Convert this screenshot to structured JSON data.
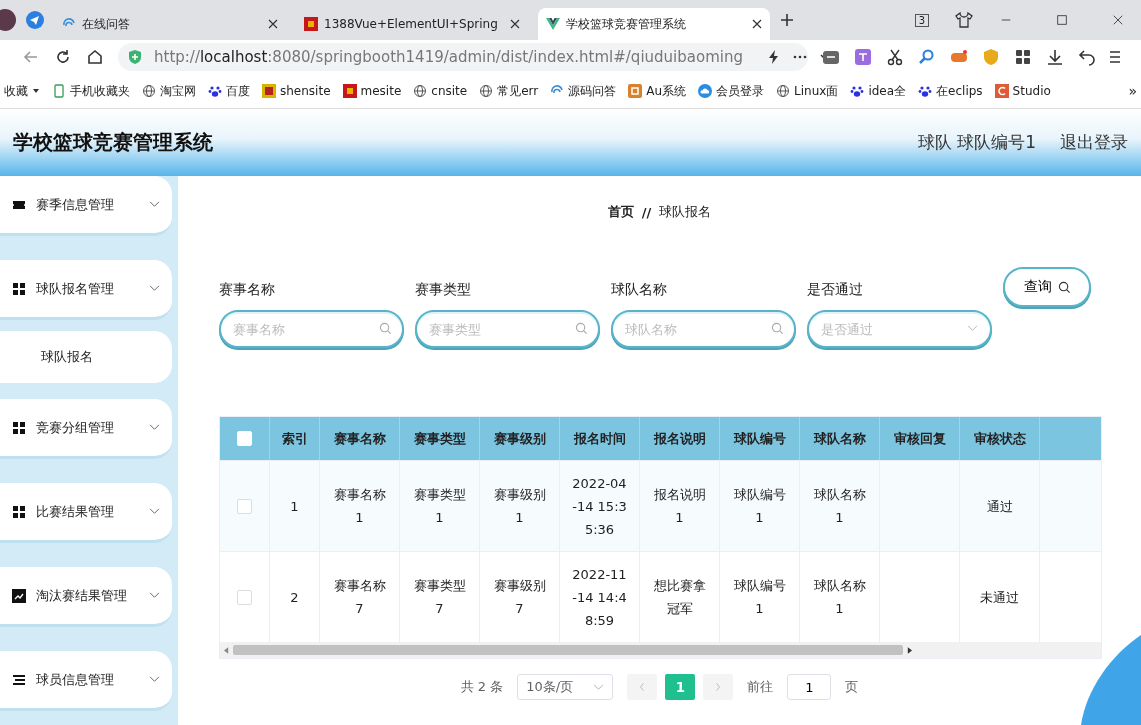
{
  "browser": {
    "tabs": [
      {
        "title": "在线问答",
        "kind": "swirl",
        "selected": false
      },
      {
        "title": "1388Vue+ElementUI+Spring",
        "kind": "red",
        "selected": false
      },
      {
        "title": "学校篮球竞赛管理系统",
        "kind": "vue",
        "selected": true
      }
    ],
    "tab_count": "3",
    "address": {
      "scheme": "http://",
      "host": "localhost",
      "path": ":8080/springbooth1419/admin/dist/index.html#/qiuduibaoming"
    },
    "bookmarks": [
      {
        "label": "收藏",
        "kind": "caret"
      },
      {
        "label": "手机收藏夹",
        "kind": "phone"
      },
      {
        "label": "淘宝网",
        "kind": "globe"
      },
      {
        "label": "百度",
        "kind": "paw"
      },
      {
        "label": "shensite",
        "kind": "shen"
      },
      {
        "label": "mesite",
        "kind": "red"
      },
      {
        "label": "cnsite",
        "kind": "globe"
      },
      {
        "label": "常见err",
        "kind": "globe"
      },
      {
        "label": "源码问答",
        "kind": "swirl"
      },
      {
        "label": "Au系统",
        "kind": "au"
      },
      {
        "label": "会员登录",
        "kind": "cloud"
      },
      {
        "label": "Linux面",
        "kind": "globe"
      },
      {
        "label": "idea全",
        "kind": "paw"
      },
      {
        "label": "在eclips",
        "kind": "paw"
      },
      {
        "label": "Studio",
        "kind": "studio"
      }
    ],
    "bookmarks_overflow": "»"
  },
  "app": {
    "title": "学校篮球竞赛管理系统",
    "user": "球队 球队编号1",
    "logout": "退出登录"
  },
  "sidebar": {
    "items": [
      {
        "label": "赛季信息管理",
        "kind": "ticket"
      },
      {
        "label": "球队报名管理",
        "kind": "grid",
        "children": [
          {
            "label": "球队报名"
          }
        ]
      },
      {
        "label": "竞赛分组管理",
        "kind": "grid"
      },
      {
        "label": "比赛结果管理",
        "kind": "grid"
      },
      {
        "label": "淘汰赛结果管理",
        "kind": "chart"
      },
      {
        "label": "球员信息管理",
        "kind": "list"
      }
    ]
  },
  "breadcrumb": {
    "items": [
      "首页",
      "球队报名"
    ],
    "separator": "//"
  },
  "search": {
    "fields": [
      {
        "label": "赛事名称",
        "placeholder": "赛事名称",
        "kind": "input"
      },
      {
        "label": "赛事类型",
        "placeholder": "赛事类型",
        "kind": "input"
      },
      {
        "label": "球队名称",
        "placeholder": "球队名称",
        "kind": "input"
      },
      {
        "label": "是否通过",
        "placeholder": "是否通过",
        "kind": "select"
      }
    ],
    "button": "查询"
  },
  "table": {
    "select_all": {
      "checked": false
    },
    "columns": [
      "索引",
      "赛事名称",
      "赛事类型",
      "赛事级别",
      "报名时间",
      "报名说明",
      "球队编号",
      "球队名称",
      "审核回复",
      "审核状态"
    ],
    "rows": [
      {
        "checked": false,
        "cells": [
          "1",
          "赛事名称1",
          "赛事类型1",
          "赛事级别1",
          "2022-04-14 15:35:36",
          "报名说明1",
          "球队编号1",
          "球队名称1",
          "",
          "通过"
        ]
      },
      {
        "checked": false,
        "cells": [
          "2",
          "赛事名称7",
          "赛事类型7",
          "赛事级别7",
          "2022-11-14 14:48:59",
          "想比赛拿冠军",
          "球队编号1",
          "球队名称1",
          "",
          "未通过"
        ]
      }
    ]
  },
  "pagination": {
    "total": "共 2 条",
    "page_size": "10条/页",
    "pages": [
      {
        "label": "1",
        "selected": true
      }
    ],
    "goto_label": "前往",
    "goto_value": "1",
    "page_suffix": "页"
  }
}
